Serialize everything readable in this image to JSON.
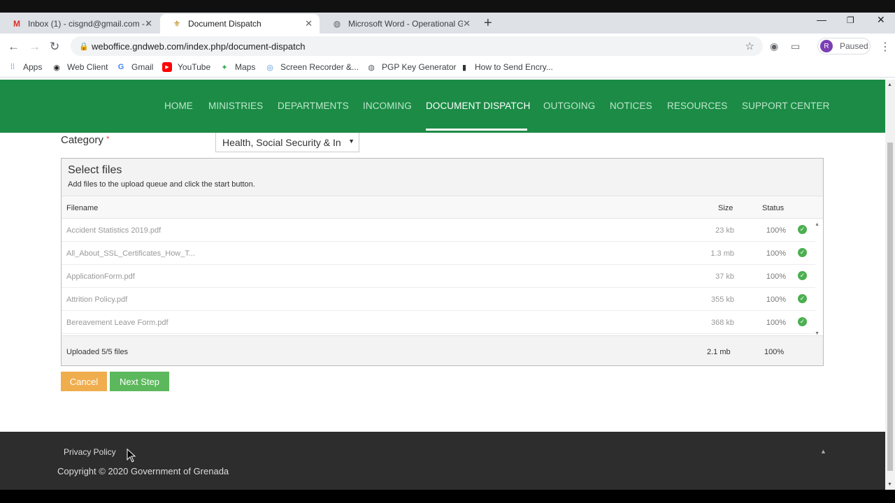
{
  "browser": {
    "tabs": [
      {
        "title": "Inbox (1) - cisgnd@gmail.com - G",
        "favicon": "gmail-icon",
        "active": false
      },
      {
        "title": "Document Dispatch",
        "favicon": "site-icon",
        "active": true
      },
      {
        "title": "Microsoft Word - Operational Gu",
        "favicon": "globe-icon",
        "active": false
      }
    ],
    "url": "weboffice.gndweb.com/index.php/document-dispatch",
    "profile_initial": "R",
    "profile_status": "Paused",
    "bookmarks": [
      {
        "label": "Apps",
        "icon": "apps-grid-icon"
      },
      {
        "label": "Web Client",
        "icon": "web-client-icon"
      },
      {
        "label": "Gmail",
        "icon": "google-icon"
      },
      {
        "label": "YouTube",
        "icon": "youtube-icon"
      },
      {
        "label": "Maps",
        "icon": "maps-icon"
      },
      {
        "label": "Screen Recorder &...",
        "icon": "screen-recorder-icon"
      },
      {
        "label": "PGP Key Generator",
        "icon": "globe-icon"
      },
      {
        "label": "How to Send Encry...",
        "icon": "encrypt-icon"
      }
    ]
  },
  "nav": {
    "items": [
      "HOME",
      "MINISTRIES",
      "DEPARTMENTS",
      "INCOMING",
      "DOCUMENT DISPATCH",
      "OUTGOING",
      "NOTICES",
      "RESOURCES",
      "SUPPORT CENTER"
    ],
    "active": "DOCUMENT DISPATCH",
    "color": "#1b8b46"
  },
  "form": {
    "category_label": "Category",
    "required_mark": "*",
    "category_value": "Health, Social Security & In"
  },
  "uploader": {
    "title": "Select files",
    "subtitle": "Add files to the upload queue and click the start button.",
    "columns": {
      "filename": "Filename",
      "size": "Size",
      "status": "Status"
    },
    "files": [
      {
        "name": "Accident Statistics 2019.pdf",
        "size": "23 kb",
        "status": "100%"
      },
      {
        "name": "All_About_SSL_Certificates_How_T...",
        "size": "1.3 mb",
        "status": "100%"
      },
      {
        "name": "ApplicationForm.pdf",
        "size": "37 kb",
        "status": "100%"
      },
      {
        "name": "Attrition Policy.pdf",
        "size": "355 kb",
        "status": "100%"
      },
      {
        "name": "Bereavement Leave Form.pdf",
        "size": "368 kb",
        "status": "100%"
      }
    ],
    "footer": {
      "uploaded": "Uploaded 5/5 files",
      "total_size": "2.1 mb",
      "total_status": "100%"
    }
  },
  "buttons": {
    "cancel": "Cancel",
    "next": "Next Step"
  },
  "footer": {
    "privacy": "Privacy Policy",
    "copyright": "Copyright © 2020 Government of Grenada"
  }
}
